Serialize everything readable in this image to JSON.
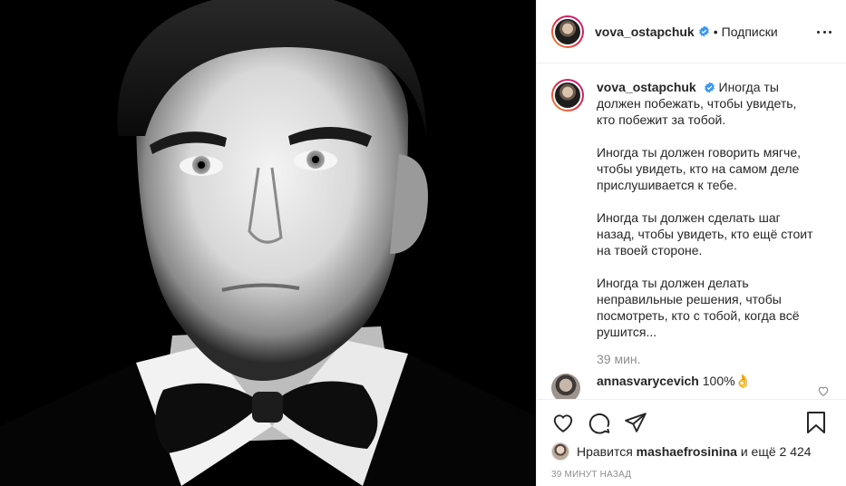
{
  "post": {
    "username": "vova_ostapchuk",
    "separator": "•",
    "follow_status": "Подписки",
    "caption": {
      "username": "vova_ostapchuk",
      "first_line": "Иногда ты должен побежать, чтобы увидеть, кто побежит за тобой.",
      "paragraphs": [
        "Иногда ты должен говорить мягче, чтобы увидеть, кто на самом деле прислушивается к тебе.",
        "Иногда ты должен сделать шаг назад, чтобы увидеть, кто ещё стоит на твоей стороне.",
        "Иногда ты должен делать неправильные решения, чтобы посмотреть, кто с тобой, когда всё рушится..."
      ],
      "time": "39 мин."
    },
    "comments": [
      {
        "username": "annasvarycevich",
        "text": "100%👌"
      }
    ],
    "likes": {
      "prefix": "Нравится",
      "liker": "mashaefrosinina",
      "suffix": "и ещё 2 424"
    },
    "posted_ago": "39 МИНУТ НАЗАД"
  },
  "icons": {
    "verified": "verified-badge-icon",
    "more": "more-options-icon",
    "like": "heart-icon",
    "comment": "comment-icon",
    "share": "share-icon",
    "save": "bookmark-icon"
  },
  "colors": {
    "accent_blue": "#3897f0",
    "muted": "#8e8e8e",
    "text": "#262626"
  }
}
